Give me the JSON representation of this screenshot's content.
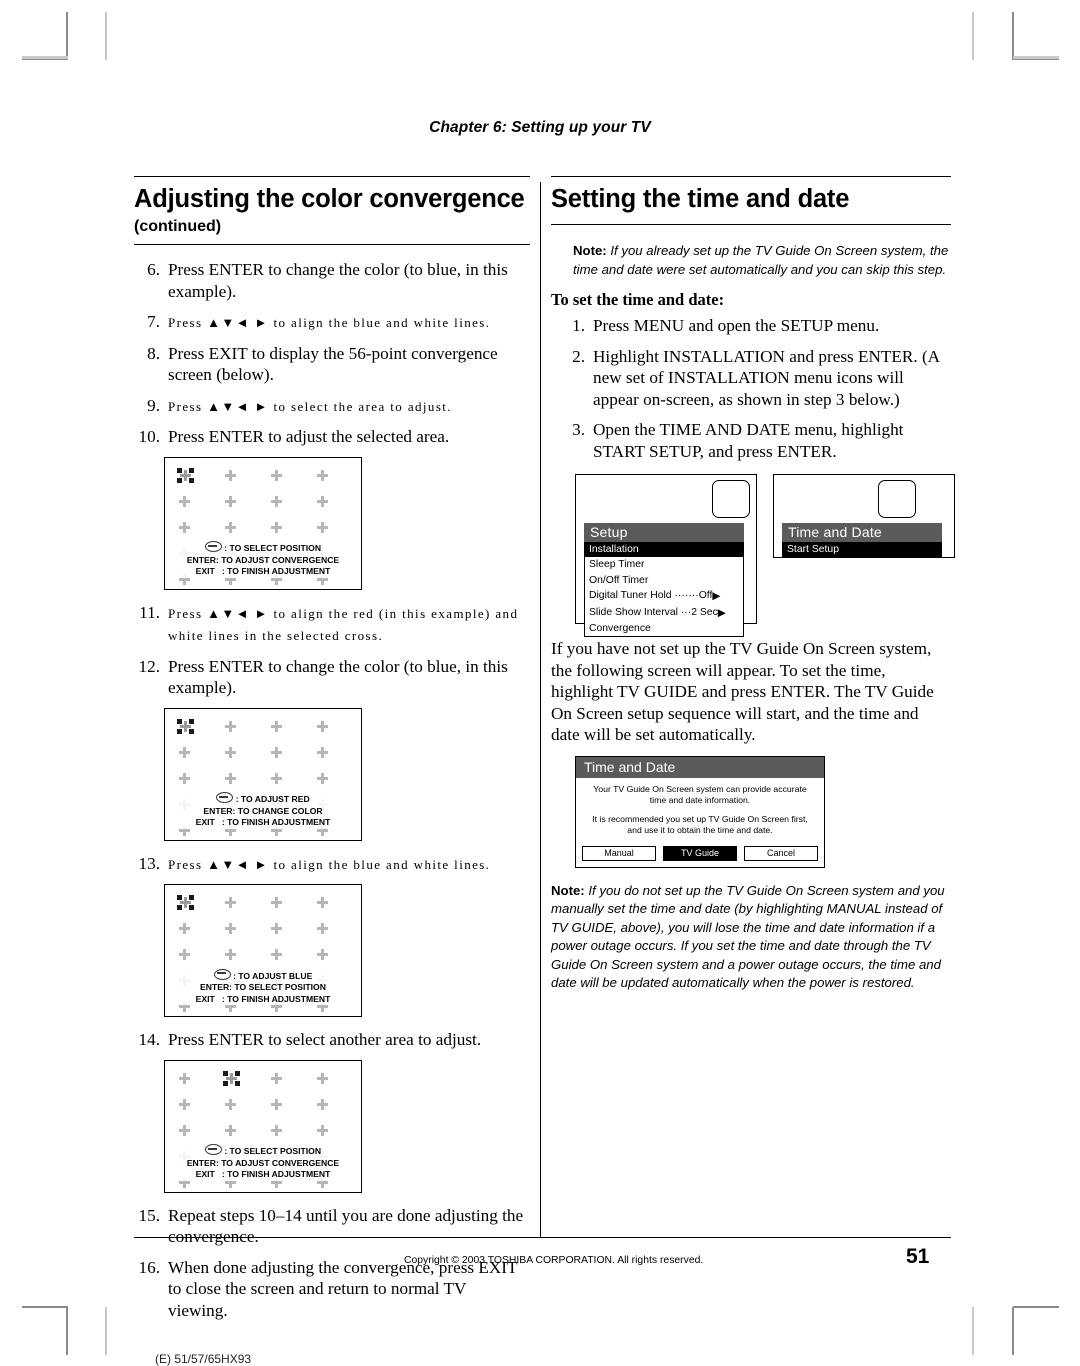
{
  "chapter_header": "Chapter 6: Setting up your TV",
  "left_column": {
    "title": "Adjusting the color convergence",
    "continued_label": "(continued)",
    "steps": [
      {
        "num": "6.",
        "text": "Press ENTER to change the color (to blue, in this example)."
      },
      {
        "num": "7.",
        "text": "Press ▲▼◄ ► to align the blue and white lines."
      },
      {
        "num": "8.",
        "text": "Press EXIT to display the 56-point convergence screen (below)."
      },
      {
        "num": "9.",
        "text": "Press ▲▼◄ ► to select the area to adjust."
      },
      {
        "num": "10.",
        "text": "Press ENTER to adjust the selected area."
      },
      {
        "num": "11.",
        "text": "Press ▲▼◄ ► to align the red (in this example) and white lines in the selected cross."
      },
      {
        "num": "12.",
        "text": "Press ENTER to change the color (to blue, in this example)."
      },
      {
        "num": "13.",
        "text": "Press ▲▼◄ ► to align the blue and white lines."
      },
      {
        "num": "14.",
        "text": "Press ENTER to select another area to adjust."
      },
      {
        "num": "15.",
        "text": "Repeat steps 10–14 until you are done adjusting the convergence."
      },
      {
        "num": "16.",
        "text": "When done adjusting the convergence, press EXIT to close the screen and return to normal TV viewing."
      }
    ],
    "convergence_screens": [
      {
        "id": "conv-1",
        "marker_column": 0,
        "legend": [
          {
            "key": "dial-icon",
            "label": ": TO SELECT POSITION"
          },
          {
            "key": "ENTER",
            "label": ": TO ADJUST CONVERGENCE"
          },
          {
            "key": "EXIT",
            "label": ": TO FINISH ADJUSTMENT"
          }
        ]
      },
      {
        "id": "conv-2",
        "marker_column": 0,
        "legend": [
          {
            "key": "dial-icon",
            "label": ": TO ADJUST RED"
          },
          {
            "key": "ENTER",
            "label": ": TO CHANGE COLOR"
          },
          {
            "key": "EXIT",
            "label": ": TO FINISH ADJUSTMENT"
          }
        ]
      },
      {
        "id": "conv-3",
        "marker_column": 0,
        "legend": [
          {
            "key": "dial-icon",
            "label": ": TO ADJUST BLUE"
          },
          {
            "key": "ENTER",
            "label": ": TO SELECT POSITION"
          },
          {
            "key": "EXIT",
            "label": ": TO FINISH ADJUSTMENT"
          }
        ]
      },
      {
        "id": "conv-4",
        "marker_column": 1,
        "legend": [
          {
            "key": "dial-icon",
            "label": ": TO SELECT POSITION"
          },
          {
            "key": "ENTER",
            "label": ": TO ADJUST CONVERGENCE"
          },
          {
            "key": "EXIT",
            "label": ": TO FINISH ADJUSTMENT"
          }
        ]
      }
    ]
  },
  "right_column": {
    "title": "Setting the time and date",
    "note_1_label": "Note:",
    "note_1_text": " If you already set up the TV Guide On Screen system, the time and date were set automatically and you can skip this step.",
    "sub_head": "To set the time and date:",
    "steps": [
      {
        "num": "1.",
        "text": "Press MENU and open the SETUP menu."
      },
      {
        "num": "2.",
        "text": "Highlight INSTALLATION and press ENTER. (A new set of INSTALLATION menu icons will appear on-screen, as shown in step 3 below.)"
      },
      {
        "num": "3.",
        "text": "Open the TIME AND DATE menu, highlight START SETUP, and press ENTER."
      }
    ],
    "paragraph": "If you have not set up the TV Guide On Screen system, the following screen will appear. To set the time, highlight TV GUIDE and press ENTER. The TV Guide On Screen setup sequence will start, and the time and date will be set automatically.",
    "note_2_label": "Note:",
    "note_2_text": " If you do not set up the TV Guide On Screen system and you manually set the time and date (by highlighting MANUAL instead of TV GUIDE, above), you will lose the time and date information if a power outage occurs. If you set the time and date through the TV Guide On Screen system and a power outage occurs, the time and date will be updated automatically when the power is restored.",
    "setup_menu": {
      "title": "Setup",
      "items": [
        {
          "label": "Installation",
          "value": "",
          "arrow": false,
          "selected": true
        },
        {
          "label": "Sleep Timer",
          "value": "",
          "arrow": false,
          "selected": false
        },
        {
          "label": "On/Off Timer",
          "value": "",
          "arrow": false,
          "selected": false
        },
        {
          "label": "Digital Tuner Hold ·······Off",
          "value": "",
          "arrow": true,
          "selected": false
        },
        {
          "label": "Slide Show Interval ···2 Sec",
          "value": "",
          "arrow": true,
          "selected": false
        },
        {
          "label": "Convergence",
          "value": "",
          "arrow": false,
          "selected": false
        }
      ]
    },
    "time_date_menu": {
      "title": "Time and Date",
      "items": [
        {
          "label": "Start Setup",
          "selected": true
        }
      ]
    },
    "time_date_dialog": {
      "title": "Time and Date",
      "line_1": "Your TV Guide On Screen system can provide accurate time and date information.",
      "line_2": "It is recommended you set up TV Guide On Screen first, and use it to obtain the time and date.",
      "buttons": [
        {
          "label": "Manual",
          "selected": false
        },
        {
          "label": "TV Guide",
          "selected": true
        },
        {
          "label": "Cancel",
          "selected": false
        }
      ]
    }
  },
  "footer": {
    "copyright": "Copyright © 2003 TOSHIBA CORPORATION. All rights reserved.",
    "page_number": "51",
    "model_code": "(E) 51/57/65HX93"
  }
}
